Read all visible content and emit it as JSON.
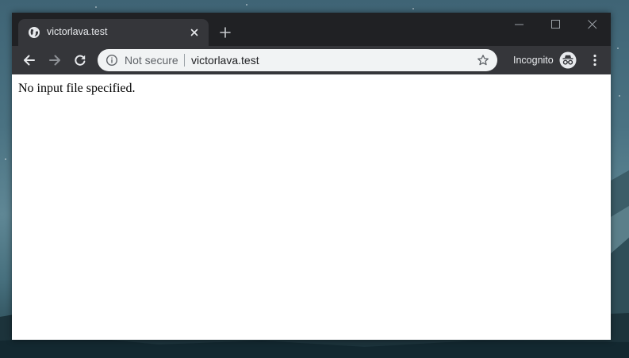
{
  "browser": {
    "tab": {
      "title": "victorlava.test",
      "favicon": "globe-icon"
    },
    "new_tab_icon": "plus-icon",
    "window_controls": [
      "minimize-icon",
      "maximize-icon",
      "close-icon"
    ],
    "toolbar": {
      "back_icon": "arrow-left-icon",
      "forward_icon": "arrow-right-icon",
      "reload_icon": "reload-icon",
      "security_icon": "info-icon",
      "security_label": "Not secure",
      "url": "victorlava.test",
      "bookmark_icon": "star-icon",
      "profile_label": "Incognito",
      "profile_icon": "incognito-icon",
      "menu_icon": "kebab-menu-icon"
    },
    "colors": {
      "titlebar": "#202124",
      "toolbar": "#35363a",
      "omnibox": "#f1f3f4"
    }
  },
  "page": {
    "message": "No input file specified."
  }
}
